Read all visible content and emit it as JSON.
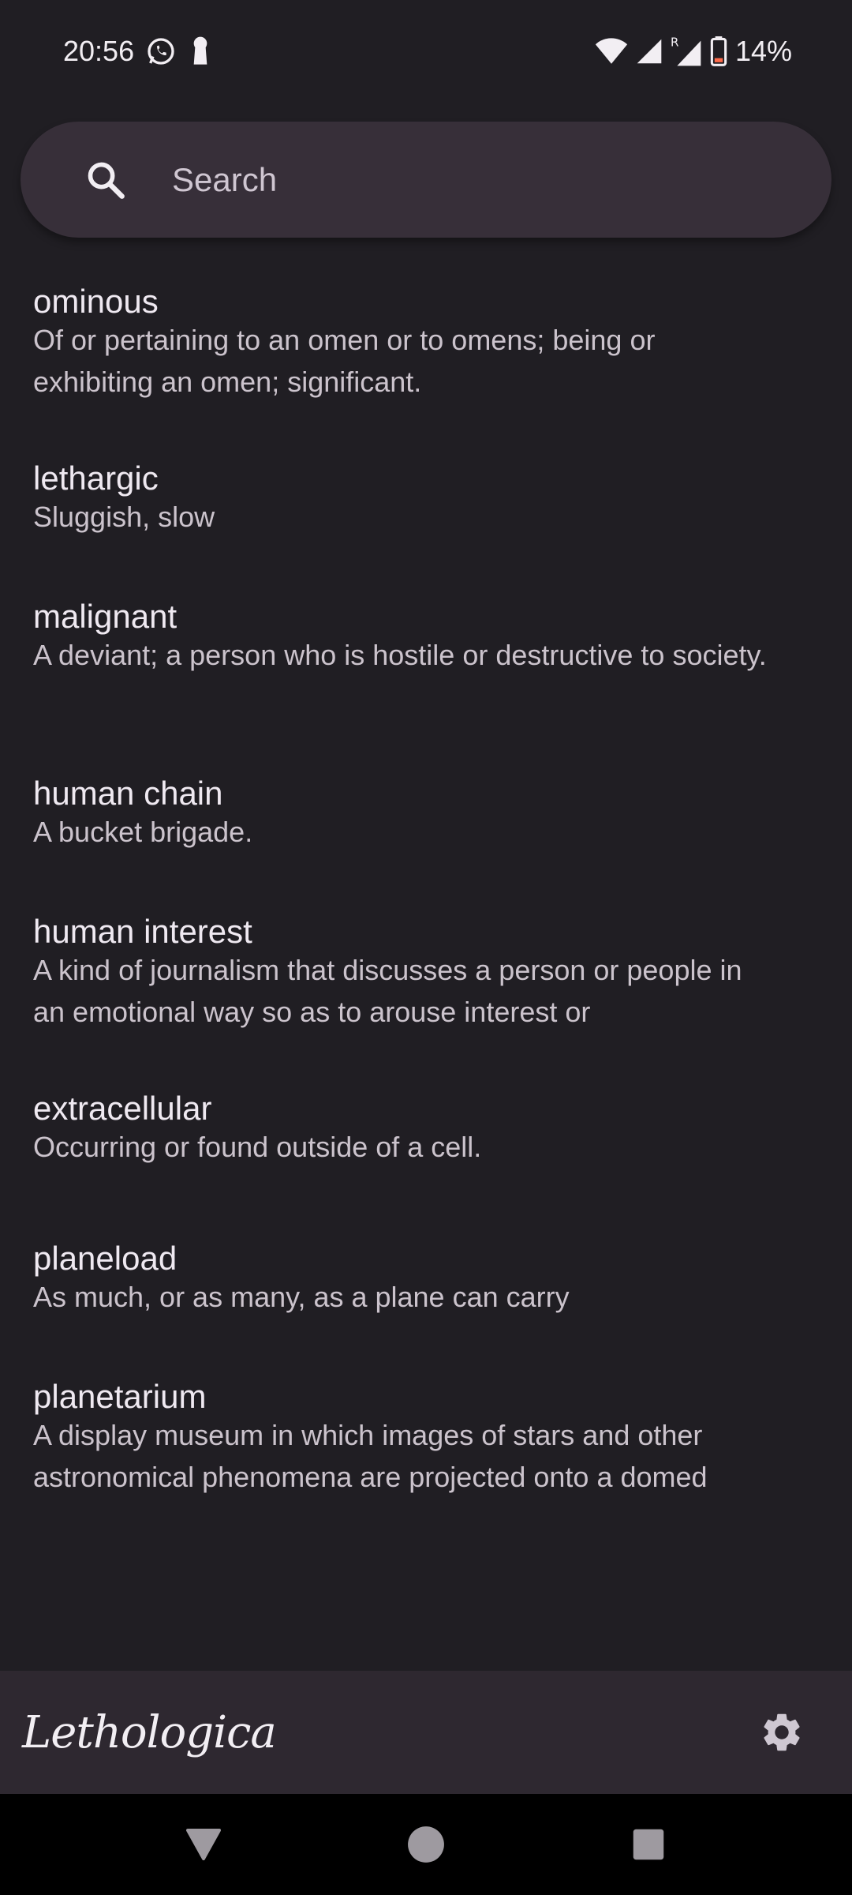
{
  "status_bar": {
    "time": "20:56",
    "battery": "14%",
    "icons": [
      "whatsapp-icon",
      "keyhole-icon",
      "wifi-icon",
      "signal-icon",
      "roaming-signal-icon",
      "battery-icon"
    ]
  },
  "search": {
    "placeholder": "Search",
    "value": ""
  },
  "entries": [
    {
      "word": "ominous",
      "definition": "Of or pertaining to an omen or to omens; being or exhibiting an omen; significant."
    },
    {
      "word": "lethargic",
      "definition": "Sluggish, slow"
    },
    {
      "word": "malignant",
      "definition": "A deviant; a person who is hostile or destructive to society."
    },
    {
      "word": "human chain",
      "definition": "A bucket brigade."
    },
    {
      "word": "human interest",
      "definition": "A kind of journalism that discusses a person or people in an emotional way so as to arouse interest or"
    },
    {
      "word": "extracellular",
      "definition": "Occurring or found outside of a cell."
    },
    {
      "word": "planeload",
      "definition": "As much, or as many, as a plane can carry"
    },
    {
      "word": "planetarium",
      "definition": "A display museum in which images of stars and other astronomical phenomena are projected onto a domed"
    }
  ],
  "bottom_bar": {
    "app_name": "Lethologica",
    "settings_icon": "gear-icon"
  },
  "nav_bar": {
    "icons": [
      "back-icon",
      "home-icon",
      "recents-icon"
    ]
  }
}
